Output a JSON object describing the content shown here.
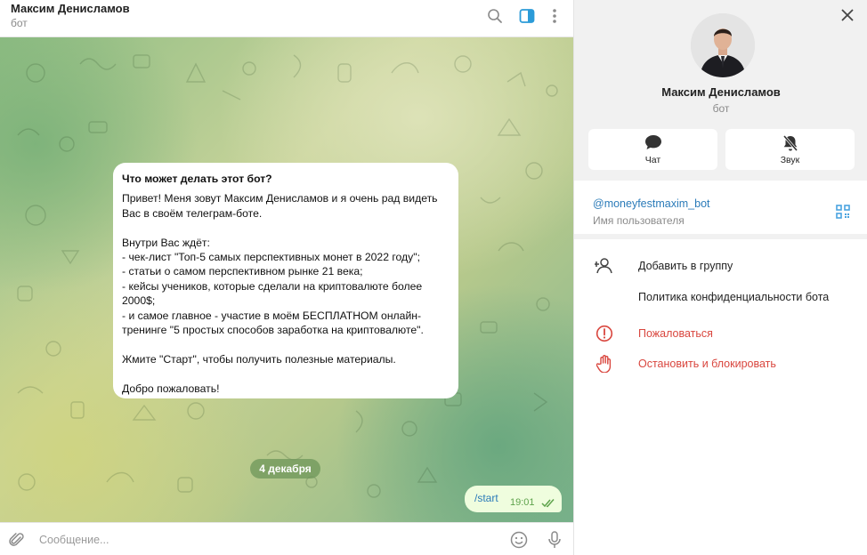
{
  "chat": {
    "title": "Максим Денисламов",
    "subtitle": "бот",
    "icons": [
      "search-icon",
      "sidebar-toggle-icon",
      "more-vertical-icon"
    ]
  },
  "bot_info": {
    "title": "Что может делать этот бот?",
    "lines": [
      "Привет! Меня зовут Максим Денисламов и я очень рад видеть",
      "Вас в своём телеграм-боте.",
      "",
      "Внутри Вас ждёт:",
      "- чек-лист \"Топ-5 самых перспективных монет в 2022 году\";",
      "- статьи о самом перспективном рынке 21 века;",
      "- кейсы учеников, которые сделали на криптовалюте более",
      "2000$;",
      "- и самое главное - участие в моём БЕСПЛАТНОМ онлайн-",
      "тренинге \"5 простых способов заработка на криптовалюте\".",
      "",
      "Жмите \"Старт\", чтобы получить полезные материалы.",
      "",
      "Добро пожаловать!"
    ]
  },
  "date_separator": "4 декабря",
  "outgoing_message": {
    "text": "/start",
    "time": "19:01",
    "status": "read"
  },
  "composer": {
    "placeholder": "Сообщение..."
  },
  "profile": {
    "name": "Максим Денисламов",
    "subtitle": "бот",
    "actions": [
      {
        "label": "Чат",
        "icon": "chat-bubble-icon"
      },
      {
        "label": "Звук",
        "icon": "bell-muted-icon"
      }
    ],
    "username": "@moneyfestmaxim_bot",
    "username_caption": "Имя пользователя",
    "menu": [
      {
        "label": "Добавить в группу",
        "icon": "add-user-icon"
      },
      {
        "label": "Политика конфиденциальности бота",
        "icon": ""
      },
      {
        "label": "Пожаловаться",
        "icon": "report-icon"
      },
      {
        "label": "Остановить и блокировать",
        "icon": "hand-stop-icon"
      }
    ]
  },
  "colors": {
    "accent": "#2b7bb9",
    "danger": "#d9463e",
    "outgoing_bubble": "#effdde",
    "read_ticks": "#5ea34c"
  }
}
